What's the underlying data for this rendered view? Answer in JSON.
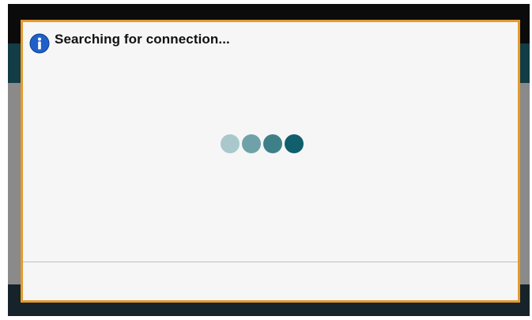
{
  "dialog": {
    "title": "Searching for connection...",
    "icon": "info-icon",
    "accent_color": "#e39a2c",
    "spinner_colors": [
      "#a9c8cb",
      "#6ea2a8",
      "#3e8089",
      "#0f5f6d"
    ]
  }
}
